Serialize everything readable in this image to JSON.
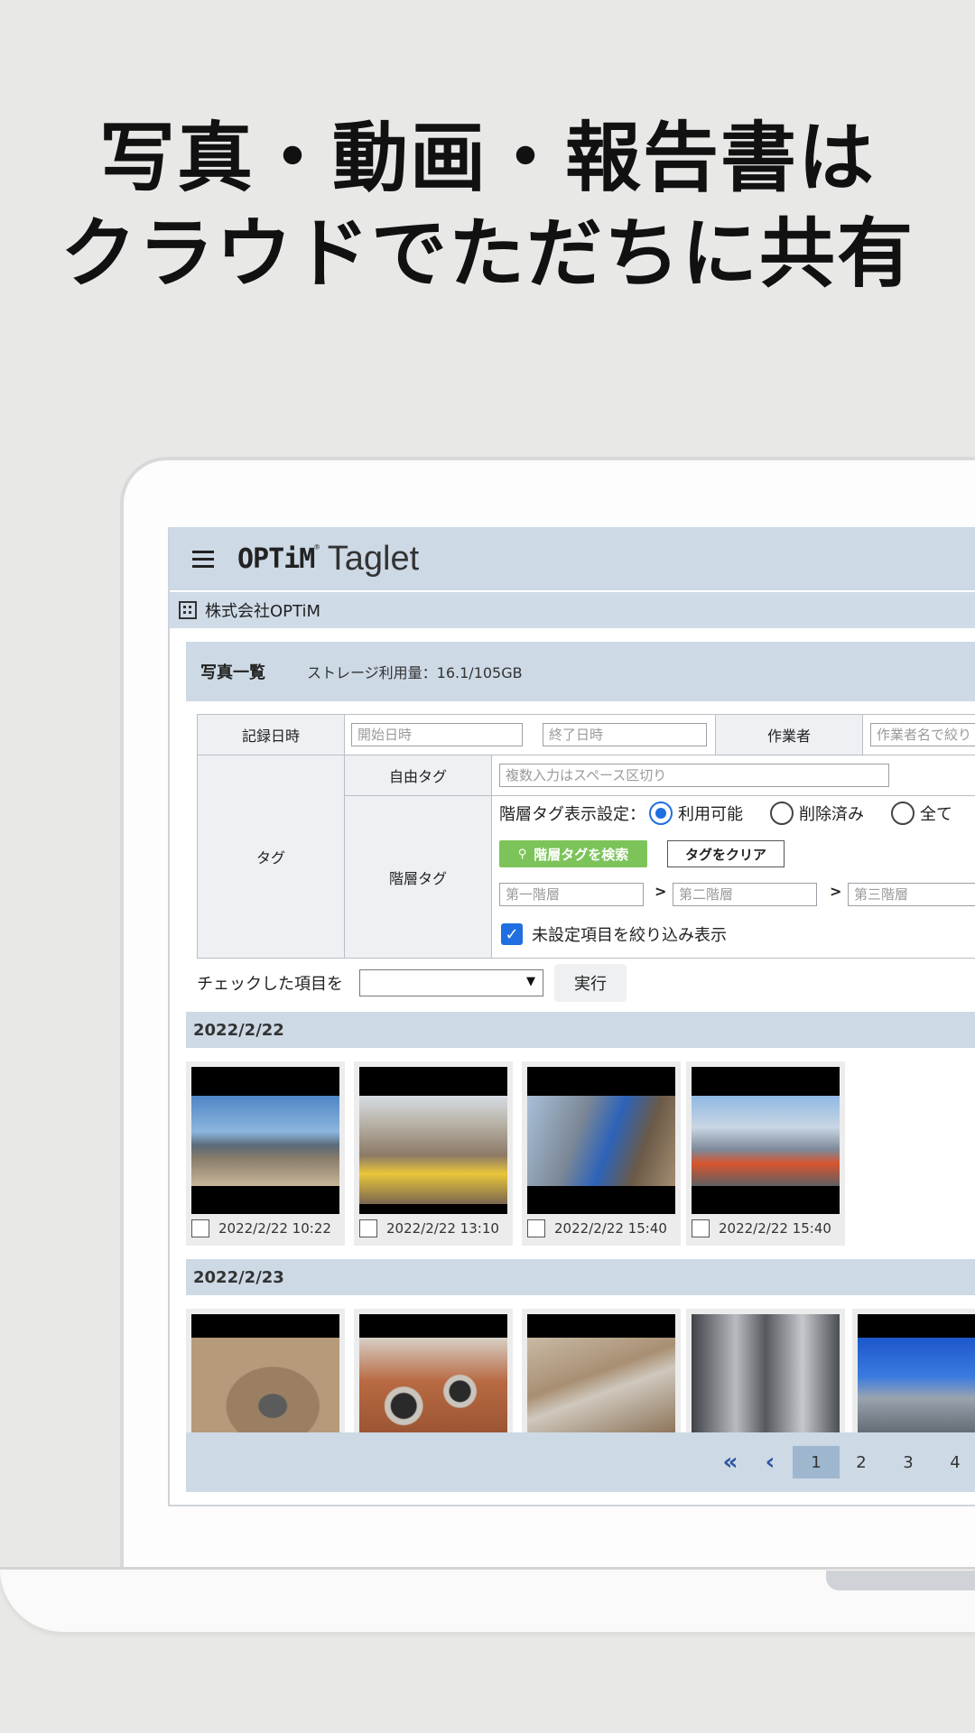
{
  "headline": {
    "line1": "写真・動画・報告書は",
    "line2": "クラウドでただちに共有"
  },
  "app": {
    "brand_optim": "OPTiM",
    "brand_reg": "®",
    "brand_taglet": "Taglet",
    "org_name": "株式会社OPTiM"
  },
  "list_header": {
    "title": "写真一覧",
    "storage": "ストレージ利用量：16.1/105GB"
  },
  "filters": {
    "record_datetime_label": "記録日時",
    "start_placeholder": "開始日時",
    "end_placeholder": "終了日時",
    "worker_label": "作業者",
    "worker_placeholder": "作業者名で絞り",
    "tag_label": "タグ",
    "free_tag_label": "自由タグ",
    "free_tag_placeholder": "複数入力はスペース区切り",
    "hier_tag_label": "階層タグ",
    "display_setting_label": "階層タグ表示設定：",
    "radio_options": [
      "利用可能",
      "削除済み",
      "全て"
    ],
    "selected_radio": "利用可能",
    "search_button": "階層タグを検索",
    "clear_button": "タグをクリア",
    "level1_placeholder": "第一階層",
    "level2_placeholder": "第二階層",
    "level3_placeholder": "第三階層",
    "separator": ">",
    "unset_filter_label": "未設定項目を絞り込み表示",
    "unset_filter_checked": true
  },
  "actions": {
    "label": "チェックした項目を",
    "select_value": "",
    "exec_button": "実行"
  },
  "groups": [
    {
      "date": "2022/2/22",
      "photos": [
        {
          "caption": "2022/2/22 10:22",
          "scene": "mountain-quarry"
        },
        {
          "caption": "2022/2/22 13:10",
          "scene": "excavation-pit"
        },
        {
          "caption": "2022/2/22 15:40",
          "scene": "excavator-trench"
        },
        {
          "caption": "2022/2/22 15:40",
          "scene": "city-roadwork"
        }
      ]
    },
    {
      "date": "2022/2/23",
      "photos": [
        {
          "scene": "manhole-dirt"
        },
        {
          "scene": "pipe-openings"
        },
        {
          "scene": "formwork-trench"
        },
        {
          "scene": "boiler-room"
        },
        {
          "scene": "industrial-piping"
        }
      ]
    }
  ],
  "pagination": {
    "first_icon": "double-chevron-left-icon",
    "prev_icon": "chevron-left-icon",
    "current": "1",
    "pages": [
      "2",
      "3",
      "4"
    ]
  }
}
